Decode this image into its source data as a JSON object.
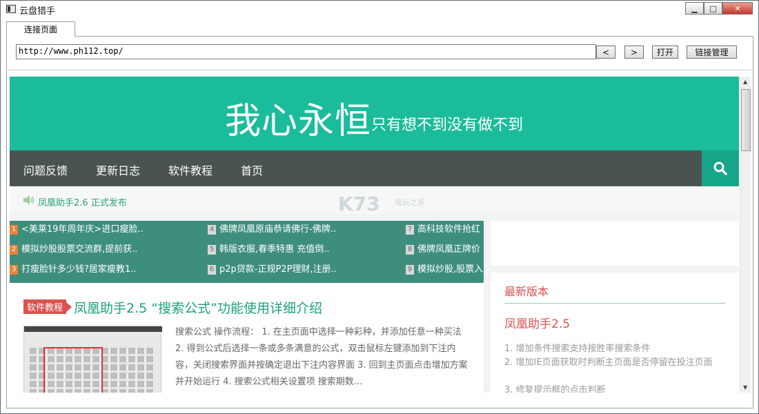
{
  "window": {
    "title": "云盘猎手",
    "ctrl_min": "▁",
    "ctrl_max": "□",
    "ctrl_close": "✕"
  },
  "tabs": [
    {
      "label": "连接页面"
    }
  ],
  "toolbar": {
    "url_value": "http://www.ph112.top/",
    "back_label": "<",
    "forward_label": ">",
    "open_label": "打开",
    "links_label": "链接管理"
  },
  "site": {
    "banner_big": "我心永恒",
    "banner_small": "只有想不到没有做不到",
    "nav": [
      "问题反馈",
      "更新日志",
      "软件教程",
      "首页"
    ],
    "notice": "凤凰助手2.6 正式发布",
    "watermark": "K73",
    "watermark_sub": "电玩之家",
    "news": [
      {
        "num": "1",
        "text": "<美莱19年周年庆>进口瘦脸..",
        "hot": true
      },
      {
        "num": "2",
        "text": "模拟炒股股票交流群,提前获..",
        "hot": true
      },
      {
        "num": "3",
        "text": "打瘦脸针多少钱?居家瘦教1..",
        "hot": true
      },
      {
        "num": "4",
        "text": "佛牌凤凰原庙恭请佛行-佛牌..",
        "hot": false
      },
      {
        "num": "5",
        "text": "韩版衣服,春季特惠 充值倒..",
        "hot": false
      },
      {
        "num": "6",
        "text": "p2p贷款-正规P2P理财,注册..",
        "hot": false
      },
      {
        "num": "7",
        "text": "高科技软件抢红",
        "hot": false
      },
      {
        "num": "8",
        "text": "佛牌凤凰正牌价",
        "hot": false
      },
      {
        "num": "9",
        "text": "模拟炒股,股票入",
        "hot": false
      }
    ],
    "article": {
      "tag": "软件教程",
      "title": "凤凰助手2.5 “搜索公式”功能使用详细介绍",
      "excerpt": "搜索公式 操作流程： 1. 在主页面中选择一种彩种，并添加任意一种买法   2. 得到公式后选择一条或多条满意的公式，双击鼠标左键添加到下注内容，关闭搜索界面并按确定退出下注内容界面 3. 回到主页面点击增加方案并开始运行 4. 搜索公式相关设置项 搜索期数..."
    },
    "sidebar": {
      "heading": "最新版本",
      "version": "凤凰助手2.5",
      "items": [
        "1. 增加条件搜索支持按胜率搜索条件",
        "2. 增加IE页面获取时判断主页面是否停留在投注页面",
        "3. 修复提示框的点击判断"
      ]
    }
  },
  "colors": {
    "accent": "#1bbc9b",
    "nav_bg": "#4a5350",
    "red": "#d9534f"
  }
}
